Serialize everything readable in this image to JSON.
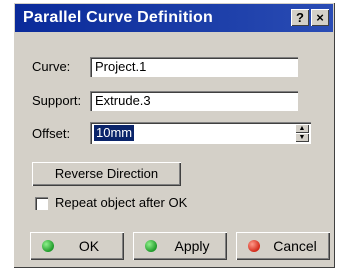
{
  "window": {
    "title": "Parallel Curve Definition"
  },
  "title_buttons": {
    "help": "?",
    "close": "×"
  },
  "form": {
    "curve_label": "Curve:",
    "curve_value": "Project.1",
    "support_label": "Support:",
    "support_value": "Extrude.3",
    "offset_label": "Offset:",
    "offset_value": "10mm"
  },
  "buttons": {
    "reverse_direction": "Reverse Direction",
    "ok": "OK",
    "apply": "Apply",
    "cancel": "Cancel"
  },
  "options": {
    "repeat_label": "Repeat object after OK",
    "repeat_checked": false
  },
  "colors": {
    "title_bar": "#0a2a9a",
    "ok_icon": "#1f9a2a",
    "apply_icon": "#1f9a2a",
    "cancel_icon": "#d22a1a"
  }
}
